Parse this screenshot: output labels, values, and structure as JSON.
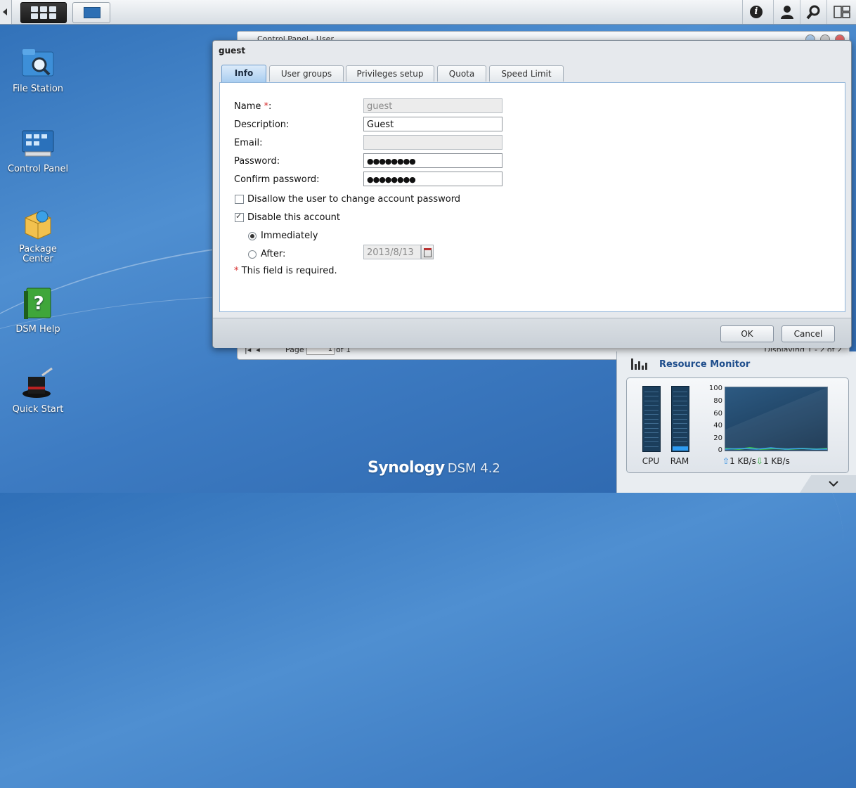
{
  "taskbar": {
    "main_menu_icon": "grid-icon",
    "open_app_icon": "control-panel-icon",
    "right_icons": [
      "info-icon",
      "user-icon",
      "search-icon",
      "widgets-icon"
    ]
  },
  "desktop": {
    "icons": [
      {
        "label": "File Station",
        "icon": "file-station-icon"
      },
      {
        "label": "Control Panel",
        "icon": "control-panel-icon"
      },
      {
        "label": "Package Center",
        "icon": "package-center-icon"
      },
      {
        "label": "DSM Help",
        "icon": "help-book-icon"
      },
      {
        "label": "Quick Start",
        "icon": "magic-hat-icon"
      }
    ],
    "brand": {
      "name": "Synology",
      "product": "DSM 4.2"
    }
  },
  "background_window": {
    "title": "Control Panel - User",
    "pager": {
      "page_label": "Page",
      "page_value": "1",
      "of_label": "of 1",
      "display_text": "Displaying 1 - 2 of 2"
    }
  },
  "dialog": {
    "title": "guest",
    "tabs": [
      {
        "label": "Info",
        "active": true
      },
      {
        "label": "User groups",
        "active": false
      },
      {
        "label": "Privileges setup",
        "active": false
      },
      {
        "label": "Quota",
        "active": false
      },
      {
        "label": "Speed Limit",
        "active": false
      }
    ],
    "form": {
      "name_label": "Name",
      "name_required_mark": "*",
      "name_colon": ":",
      "name_value": "guest",
      "description_label": "Description:",
      "description_value": "Guest",
      "email_label": "Email:",
      "email_value": "",
      "password_label": "Password:",
      "password_value": "●●●●●●●●",
      "confirm_password_label": "Confirm password:",
      "confirm_password_value": "●●●●●●●●",
      "disallow_change_label": "Disallow the user to change account password",
      "disallow_change_checked": false,
      "disable_account_label": "Disable this account",
      "disable_account_checked": true,
      "immediately_label": "Immediately",
      "immediately_selected": true,
      "after_label": "After:",
      "after_selected": false,
      "after_date": "2013/8/13",
      "required_note_mark": "*",
      "required_note": "This field is required."
    },
    "buttons": {
      "ok": "OK",
      "cancel": "Cancel"
    }
  },
  "resource_monitor": {
    "title": "Resource Monitor",
    "cpu_label": "CPU",
    "ram_label": "RAM",
    "cpu_percent": 0,
    "ram_percent": 7,
    "chart_yticks": [
      "100",
      "80",
      "60",
      "40",
      "20",
      "0"
    ],
    "upload": "1 KB/s",
    "download": "1 KB/s",
    "colors": {
      "meter_fill": "#2e9cf2",
      "upload_arrow": "#2d8be0",
      "download_arrow": "#2fae3b"
    }
  }
}
